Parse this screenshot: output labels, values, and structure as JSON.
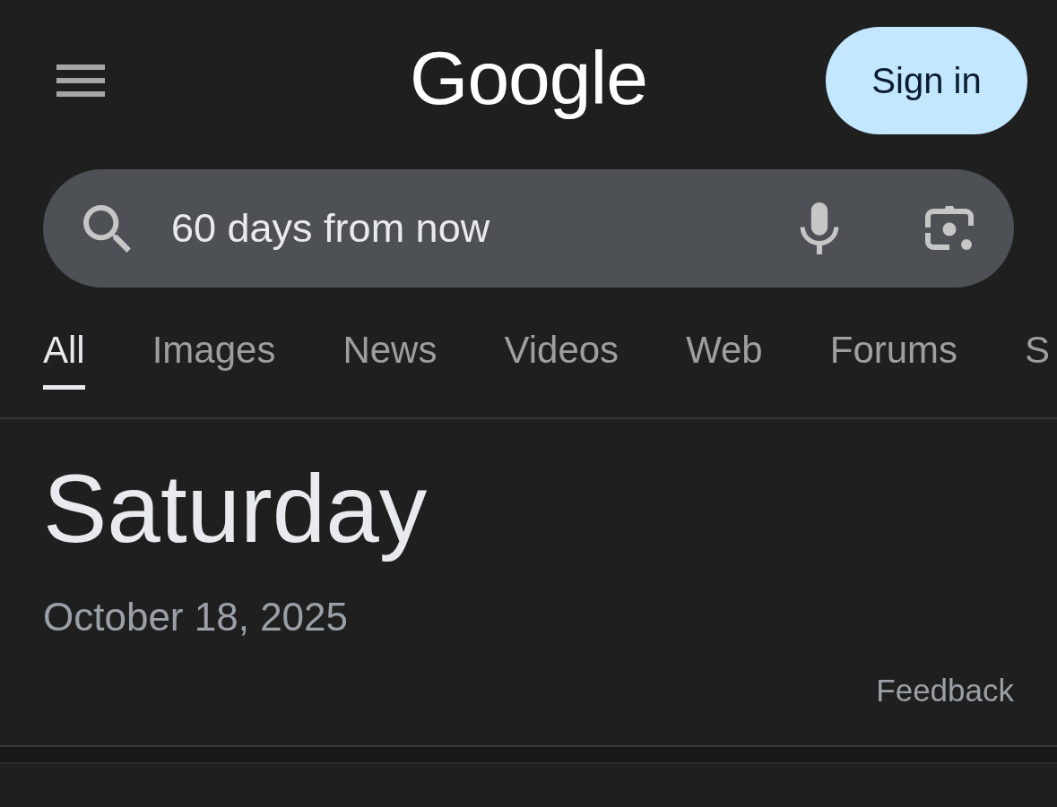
{
  "header": {
    "logo": "Google",
    "sign_in_button": "Sign in"
  },
  "search": {
    "value": "60 days from now"
  },
  "tabs": [
    {
      "label": "All",
      "selected": true
    },
    {
      "label": "Images",
      "selected": false
    },
    {
      "label": "News",
      "selected": false
    },
    {
      "label": "Videos",
      "selected": false
    },
    {
      "label": "Web",
      "selected": false
    },
    {
      "label": "Forums",
      "selected": false
    },
    {
      "label": "S",
      "selected": false
    }
  ],
  "answer": {
    "day": "Saturday",
    "date": "October 18, 2025",
    "feedback": "Feedback"
  }
}
